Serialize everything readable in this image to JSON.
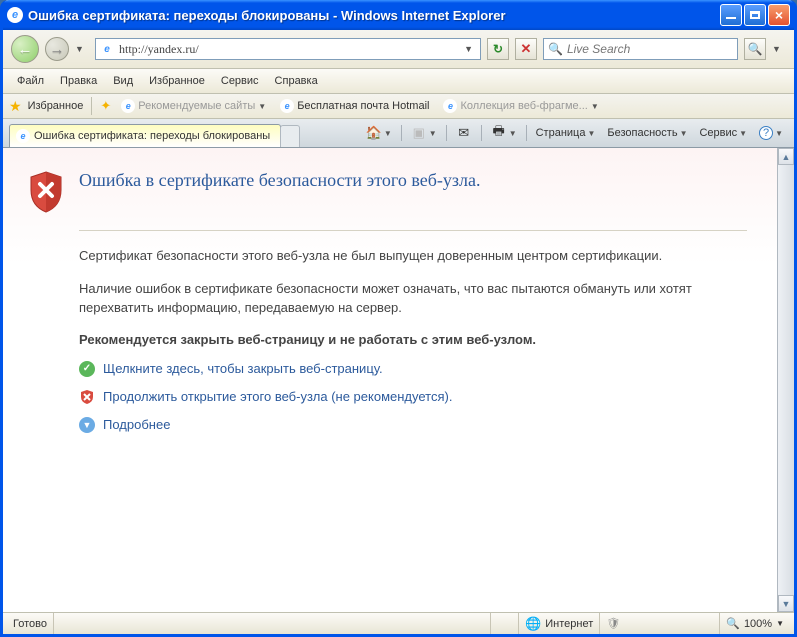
{
  "window": {
    "title": "Ошибка сертификата: переходы блокированы - Windows Internet Explorer"
  },
  "navbar": {
    "url": "http://yandex.ru/",
    "search_placeholder": "Live Search"
  },
  "menu": {
    "file": "Файл",
    "edit": "Правка",
    "view": "Вид",
    "favorites": "Избранное",
    "tools": "Сервис",
    "help": "Справка"
  },
  "favbar": {
    "favorites": "Избранное",
    "suggested": "Рекомендуемые сайты",
    "hotmail": "Бесплатная почта Hotmail",
    "fragments": "Коллекция веб-фрагме..."
  },
  "tab": {
    "title": "Ошибка сертификата: переходы блокированы"
  },
  "tools": {
    "page": "Страница",
    "safety": "Безопасность",
    "service": "Сервис"
  },
  "cert": {
    "title": "Ошибка в сертификате безопасности этого веб-узла.",
    "p1": "Сертификат безопасности этого веб-узла не был выпущен доверенным центром сертификации.",
    "p2": "Наличие ошибок в сертификате безопасности может означать, что вас пытаются обмануть или хотят перехватить информацию, передаваемую на сервер.",
    "recommend": "Рекомендуется закрыть веб-страницу и не работать с этим веб-узлом.",
    "close": "Щелкните здесь, чтобы закрыть веб-страницу.",
    "continue": "Продолжить открытие этого веб-узла (не рекомендуется).",
    "more": "Подробнее"
  },
  "status": {
    "ready": "Готово",
    "zone": "Интернет",
    "zoom": "100%"
  }
}
